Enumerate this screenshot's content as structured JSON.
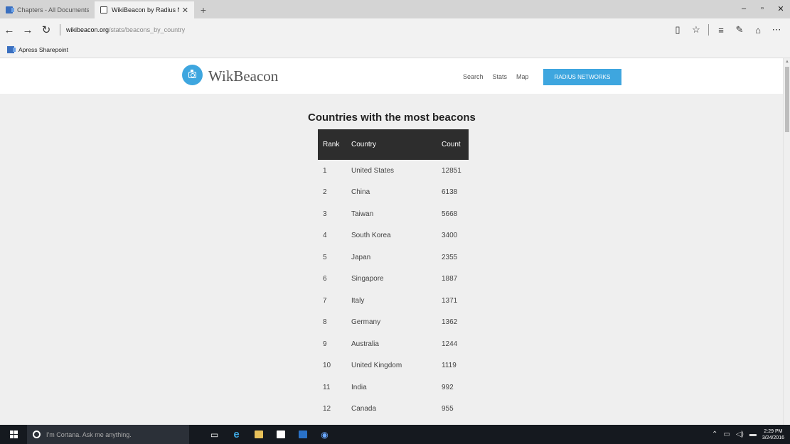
{
  "browser": {
    "tabs": [
      {
        "title": "Chapters - All Documents",
        "active": false
      },
      {
        "title": "WikiBeacon by Radius N",
        "active": true
      }
    ],
    "new_tab_label": "+",
    "address": {
      "domain": "wikibeacon.org",
      "path": "/stats/beacons_by_country"
    },
    "favorites": [
      {
        "label": "Apress Sharepoint"
      }
    ],
    "window_controls": {
      "minimize": "–",
      "maximize": "▫",
      "close": "✕"
    }
  },
  "site": {
    "logo_text": "WikBeacon",
    "nav": [
      "Search",
      "Stats",
      "Map"
    ],
    "cta_label": "RADIUS NETWORKS",
    "accent_color": "#3ea6df"
  },
  "table": {
    "title": "Countries with the most beacons",
    "headers": {
      "rank": "Rank",
      "country": "Country",
      "count": "Count"
    },
    "rows": [
      {
        "rank": "1",
        "country": "United States",
        "count": "12851"
      },
      {
        "rank": "2",
        "country": "China",
        "count": "6138"
      },
      {
        "rank": "3",
        "country": "Taiwan",
        "count": "5668"
      },
      {
        "rank": "4",
        "country": "South Korea",
        "count": "3400"
      },
      {
        "rank": "5",
        "country": "Japan",
        "count": "2355"
      },
      {
        "rank": "6",
        "country": "Singapore",
        "count": "1887"
      },
      {
        "rank": "7",
        "country": "Italy",
        "count": "1371"
      },
      {
        "rank": "8",
        "country": "Germany",
        "count": "1362"
      },
      {
        "rank": "9",
        "country": "Australia",
        "count": "1244"
      },
      {
        "rank": "10",
        "country": "United Kingdom",
        "count": "1119"
      },
      {
        "rank": "11",
        "country": "India",
        "count": "992"
      },
      {
        "rank": "12",
        "country": "Canada",
        "count": "955"
      }
    ]
  },
  "taskbar": {
    "cortana_placeholder": "I'm Cortana. Ask me anything.",
    "apps": [
      "task-view-icon",
      "edge-icon",
      "file-explorer-icon",
      "store-icon",
      "outlook-icon",
      "app-icon"
    ],
    "clock_time": "2:29 PM",
    "clock_date": "3/24/2016"
  }
}
